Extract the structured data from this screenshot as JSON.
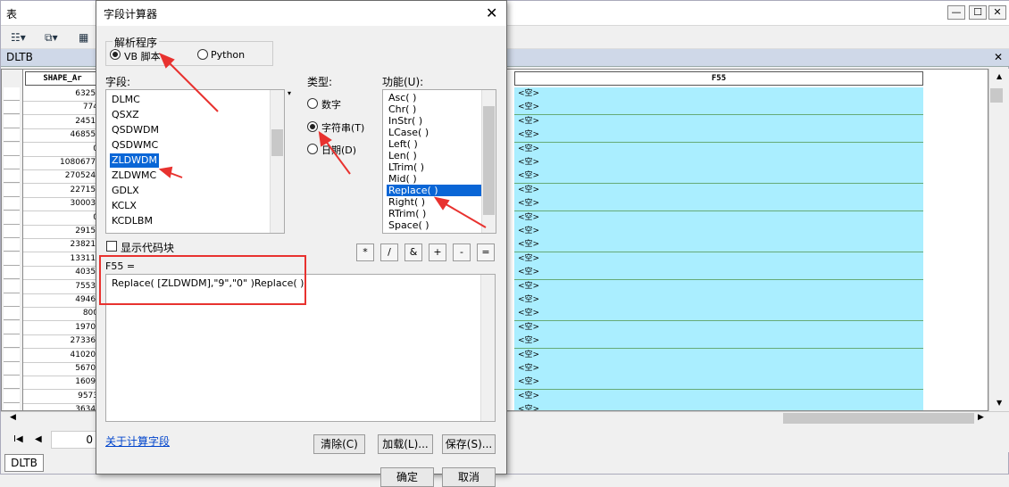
{
  "table_window": {
    "title": "表",
    "minimize": "—",
    "maximize": "☐",
    "close": "✕",
    "tab_name": "DLTB",
    "tab_close": "✕",
    "bottom_tab": "DLTB",
    "nav_first": "I◀",
    "nav_prev": "◀",
    "nav_record": "0"
  },
  "grid": {
    "col_shape_header": "SHAPE_Ar",
    "col_f55_header": "F55",
    "shape_values": [
      "6325.",
      "774",
      "2451.",
      "46855.",
      "0",
      "1080677.",
      "270524.",
      "22715.",
      "30003.",
      "0",
      "2915.",
      "23821.",
      "13311.",
      "4035.",
      "7553.",
      "4946.",
      "800",
      "1970.",
      "27336.",
      "41020.",
      "5670.",
      "1609.",
      "9573",
      "3634."
    ],
    "f55_values": [
      "<空>",
      "<空>",
      "<空>",
      "<空>",
      "<空>",
      "<空>",
      "<空>",
      "<空>",
      "<空>",
      "<空>",
      "<空>",
      "<空>",
      "<空>",
      "<空>",
      "<空>",
      "<空>",
      "<空>",
      "<空>",
      "<空>",
      "<空>",
      "<空>",
      "<空>",
      "<空>",
      "<空>"
    ]
  },
  "dialog": {
    "title": "字段计算器",
    "close": "✕",
    "parser_group": "解析程序",
    "parser_vb": "VB 脚本",
    "parser_python": "Python",
    "fields_label": "字段:",
    "fields": [
      "DLMC",
      "QSXZ",
      "QSDWDM",
      "QSDWMC",
      "ZLDWDM",
      "ZLDWMC",
      "GDLX",
      "KCLX",
      "KCDLBM"
    ],
    "fields_selected": "ZLDWDM",
    "type_label": "类型:",
    "type_number": "数字",
    "type_string": "字符串(T)",
    "type_date": "日期(D)",
    "functions_label": "功能(U):",
    "functions": [
      "Asc( )",
      "Chr( )",
      "InStr( )",
      "LCase( )",
      "Left( )",
      "Len( )",
      "LTrim( )",
      "Mid( )",
      "Replace( )",
      "Right( )",
      "RTrim( )",
      "Space( )"
    ],
    "functions_selected": "Replace( )",
    "show_codeblock": "显示代码块",
    "ops": [
      "*",
      "/",
      "&",
      "+",
      "-",
      "="
    ],
    "expr_label": "F55 =",
    "expr_value": "Replace( [ZLDWDM],\"9\",\"0\" )Replace( )",
    "about_link": "关于计算字段",
    "clear_button": "清除(C)",
    "load_button": "加载(L)...",
    "save_button": "保存(S)...",
    "ok_button": "确定",
    "cancel_button": "取消"
  },
  "colors": {
    "accent_red": "#e8322f",
    "selection_blue": "#0a66d6",
    "cell_cyan": "#aaeeff"
  }
}
